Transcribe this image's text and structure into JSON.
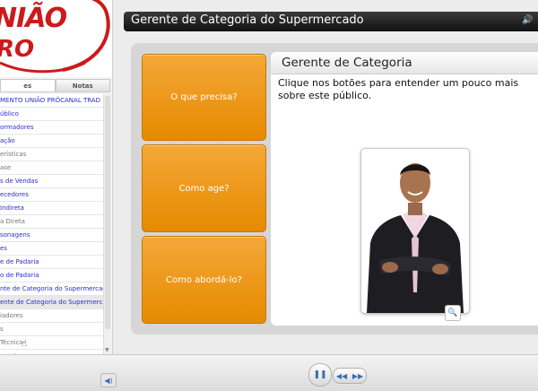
{
  "logo": {
    "line1": "NIÃO",
    "line2": "RO"
  },
  "sidebar": {
    "tabs": [
      "es",
      "Notas"
    ],
    "outline": [
      {
        "label": "MENTO UNIÃO PRÓCANAL TRAD",
        "style": "link"
      },
      {
        "label": "úblico",
        "style": "link"
      },
      {
        "label": "ormadores",
        "style": "link"
      },
      {
        "label": "ação",
        "style": "link"
      },
      {
        "label": "erísticas",
        "style": "gray"
      },
      {
        "label": "ase",
        "style": "gray"
      },
      {
        "label": "s de Vendas",
        "style": "link"
      },
      {
        "label": "ecedores",
        "style": "link"
      },
      {
        "label": "Indireta",
        "style": "link"
      },
      {
        "label": "a Direta",
        "style": "gray"
      },
      {
        "label": "sonagens",
        "style": "link"
      },
      {
        "label": "es",
        "style": "link"
      },
      {
        "label": "e de Padaria",
        "style": "link"
      },
      {
        "label": "o de Padaria",
        "style": "link"
      },
      {
        "label": "nte de  Categoria do Supermercado",
        "style": "link"
      },
      {
        "label": "ente de  Categoria do Supermercado",
        "style": "link selected"
      },
      {
        "label": "iadores",
        "style": "gray"
      },
      {
        "label": "s",
        "style": "gray"
      },
      {
        "label": "Técnico",
        "style": "gray"
      },
      {
        "label": "mento",
        "style": "gray"
      }
    ]
  },
  "header": {
    "title": "Gerente de  Categoria do Supermercado"
  },
  "buttons": [
    "O que precisa?",
    "Como age?",
    "Como abordá-lo?"
  ],
  "panel": {
    "title": "Gerente de Categoria",
    "description": "Clique nos botões para entender um pouco mais sobre este público."
  },
  "colors": {
    "accent_orange": "#f09a1a",
    "brand_red": "#cc1a1a",
    "link_blue": "#2c2ccc"
  }
}
